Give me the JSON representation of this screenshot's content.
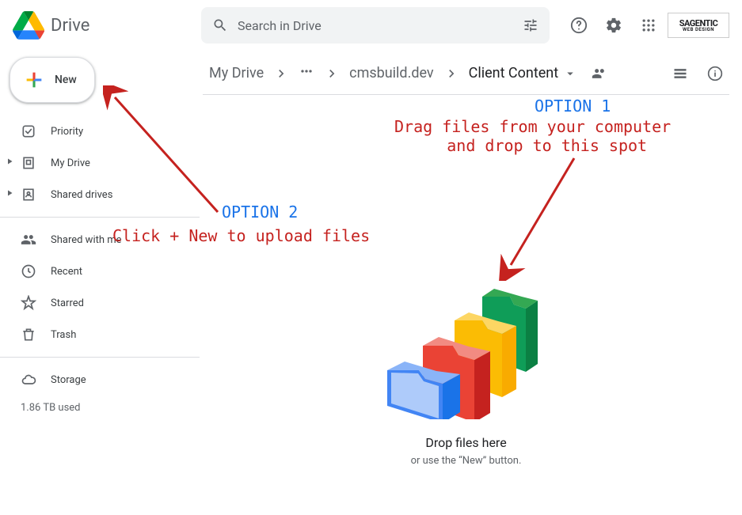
{
  "header": {
    "app_name": "Drive",
    "search_placeholder": "Search in Drive"
  },
  "brand_badge": {
    "top": "SAGENTIC",
    "bottom": "WEB DESIGN"
  },
  "sidebar": {
    "new_label": "New",
    "items": [
      {
        "label": "Priority",
        "icon": "priority"
      },
      {
        "label": "My Drive",
        "icon": "mydrive",
        "expandable": true
      },
      {
        "label": "Shared drives",
        "icon": "shareddrives",
        "expandable": true
      }
    ],
    "items2": [
      {
        "label": "Shared with me",
        "icon": "shared"
      },
      {
        "label": "Recent",
        "icon": "recent"
      },
      {
        "label": "Starred",
        "icon": "starred"
      },
      {
        "label": "Trash",
        "icon": "trash"
      }
    ],
    "storage_label": "Storage",
    "storage_used": "1.86 TB used"
  },
  "breadcrumb": {
    "root": "My Drive",
    "mid": "cmsbuild.dev",
    "current": "Client Content"
  },
  "drop": {
    "title": "Drop files here",
    "subtitle": "or use the “New” button."
  },
  "annotations": {
    "option1_label": "OPTION 1",
    "option1_text": "Drag files from your computer\n   and drop to this spot",
    "option2_label": "OPTION 2",
    "option2_text": "Click + New to upload files"
  }
}
